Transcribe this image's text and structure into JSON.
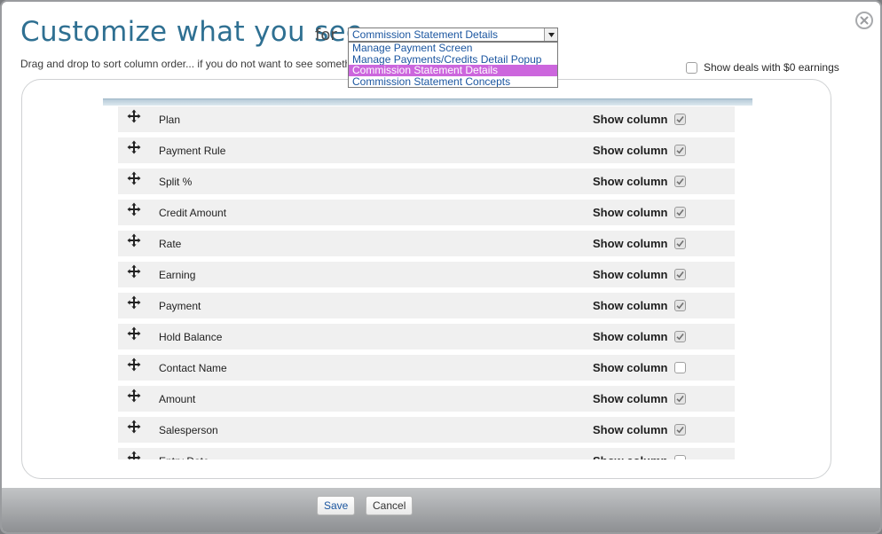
{
  "dialog": {
    "title": "Customize what you see",
    "for_label": "for",
    "instructions": "Drag and drop to sort column order... if you do not want to see something, uncheck \"Show column\".",
    "close_icon": "close-circle-icon"
  },
  "screen_select": {
    "selected": "Commission Statement Details",
    "options": [
      "Manage Payment Screen",
      "Manage Payments/Credits Detail Popup",
      "Commission Statement Details",
      "Commission Statement Concepts"
    ],
    "selected_index": 2
  },
  "show_zero": {
    "label": "Show deals with $0 earnings",
    "checked": false
  },
  "columns": {
    "show_label": "Show column",
    "drag_icon": "move-arrows-icon",
    "items": [
      {
        "label": "Plan",
        "checked": true
      },
      {
        "label": "Payment Rule",
        "checked": true
      },
      {
        "label": "Split %",
        "checked": true
      },
      {
        "label": "Credit Amount",
        "checked": true
      },
      {
        "label": "Rate",
        "checked": true
      },
      {
        "label": "Earning",
        "checked": true
      },
      {
        "label": "Payment",
        "checked": true
      },
      {
        "label": "Hold Balance",
        "checked": true
      },
      {
        "label": "Contact Name",
        "checked": false
      },
      {
        "label": "Amount",
        "checked": true
      },
      {
        "label": "Salesperson",
        "checked": true
      },
      {
        "label": "Entry Date",
        "checked": false
      }
    ]
  },
  "footer": {
    "save_label": "Save",
    "cancel_label": "Cancel"
  },
  "colors": {
    "title": "#2f7092",
    "link": "#1b56a0",
    "selected_option": "#cc66dd"
  }
}
